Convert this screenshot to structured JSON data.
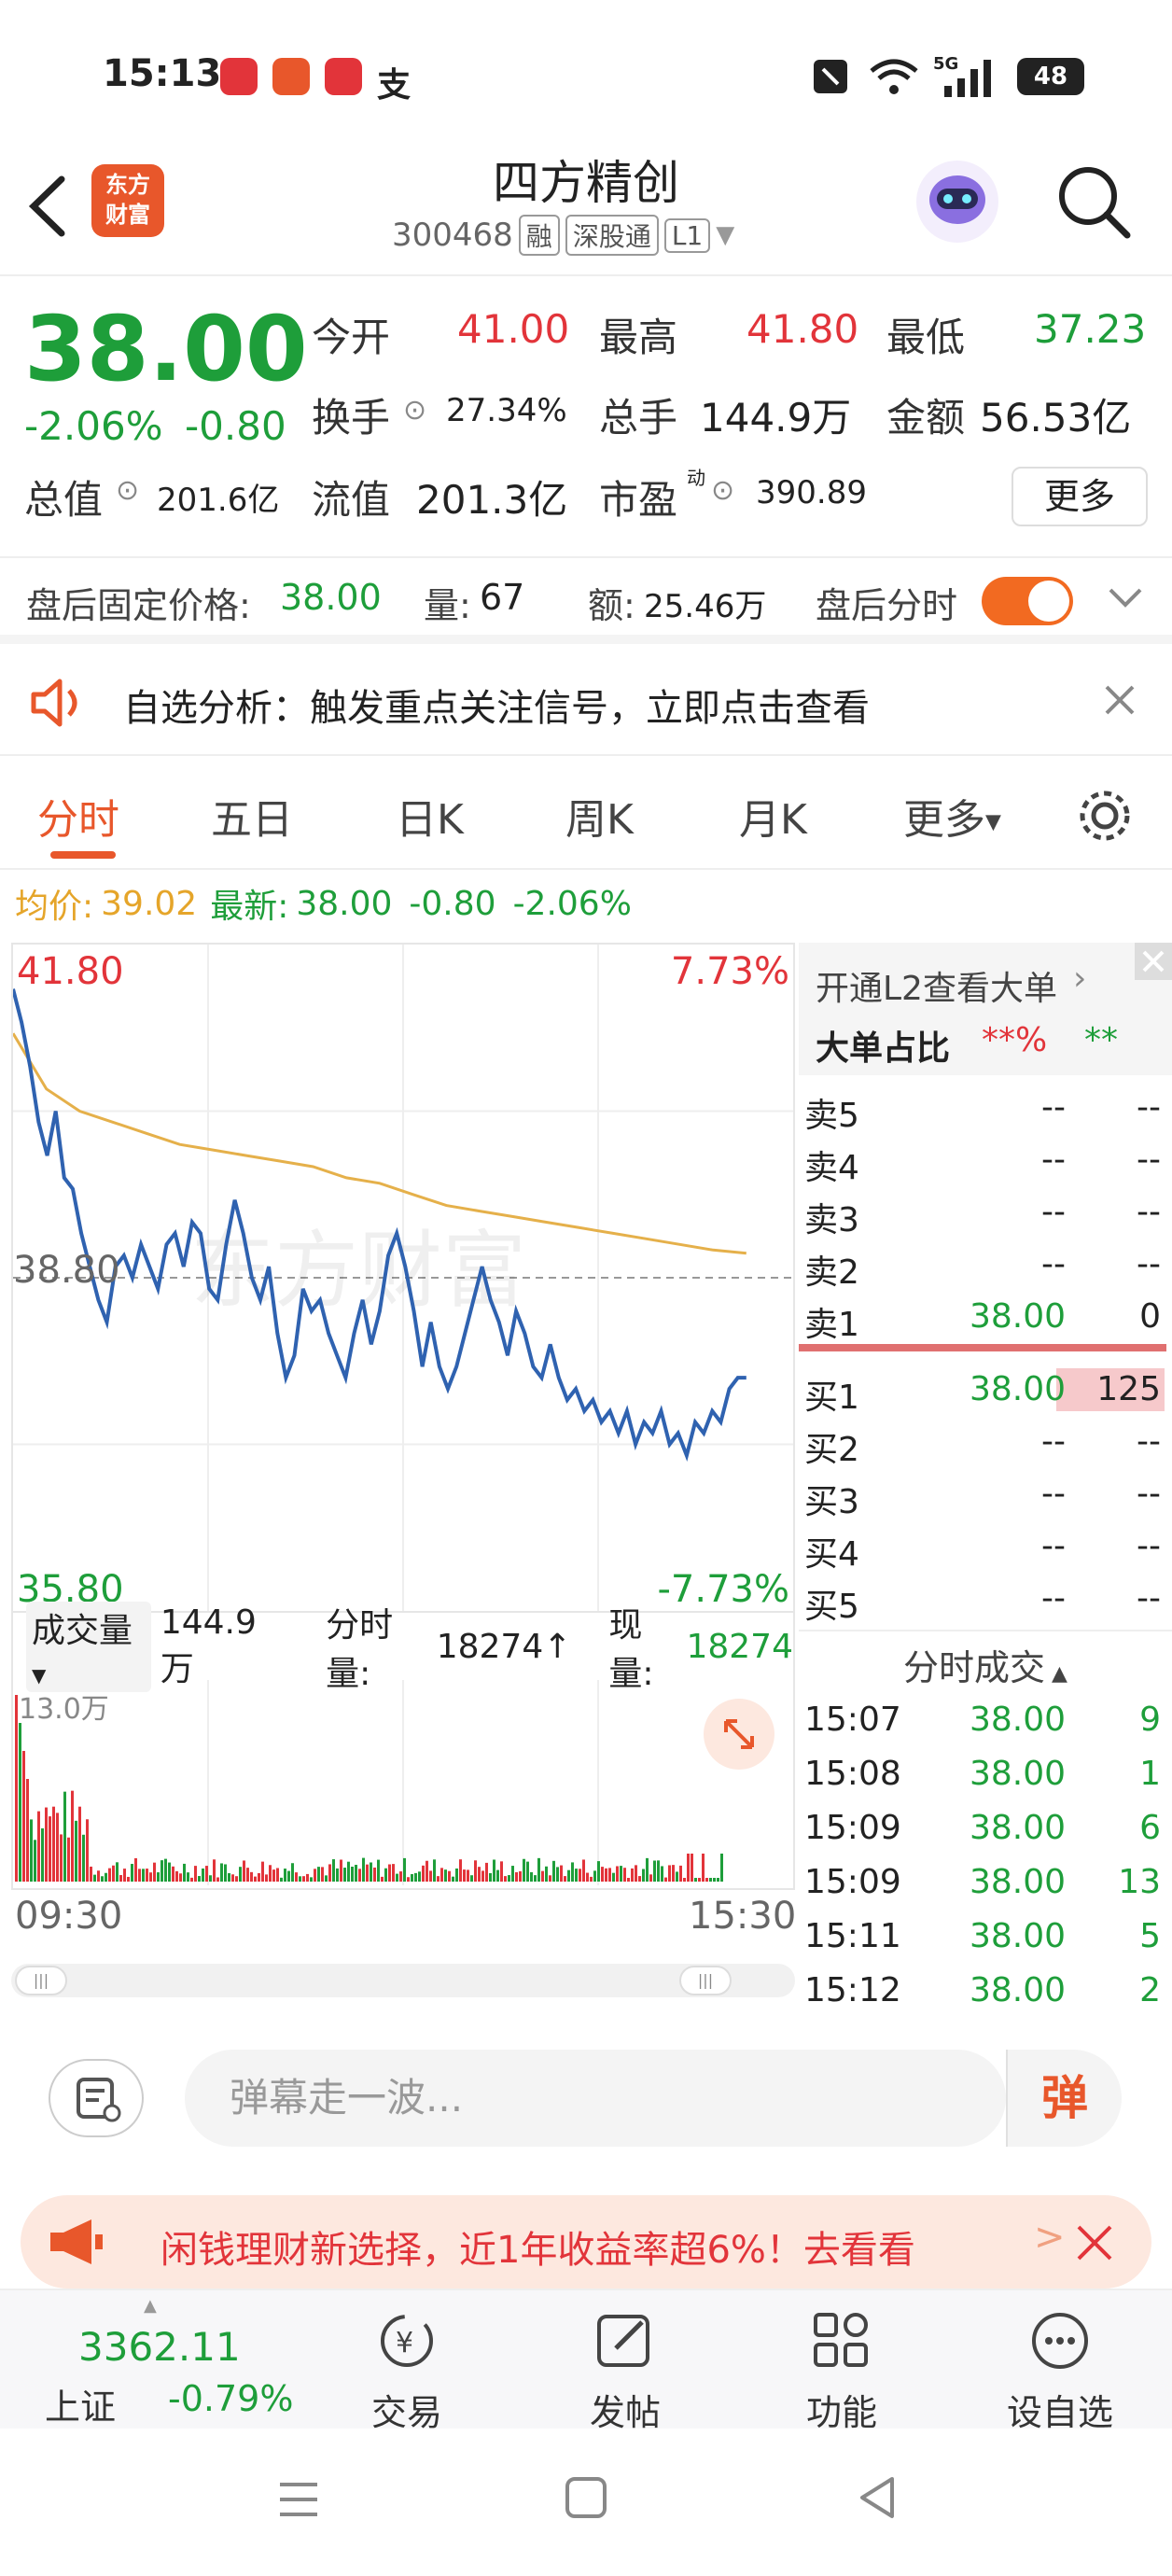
{
  "status_bar": {
    "time": "15:13",
    "battery": "48",
    "signal": "5G"
  },
  "header": {
    "brand_logo": "东方财富",
    "stock_name": "四方精创",
    "stock_code": "300468",
    "tags": [
      "融",
      "深股通",
      "L1"
    ]
  },
  "quote": {
    "price": "38.00",
    "change_pct": "-2.06%",
    "change": "-0.80",
    "open_label": "今开",
    "open": "41.00",
    "high_label": "最高",
    "high": "41.80",
    "low_label": "最低",
    "low": "37.23",
    "turnover_label": "换手",
    "turnover": "27.34%",
    "volume_label": "总手",
    "volume": "144.9万",
    "amount_label": "金额",
    "amount": "56.53亿",
    "mktcap_label": "总值",
    "mktcap": "201.6亿",
    "float_label": "流值",
    "float": "201.3亿",
    "pe_label": "市盈",
    "pe_sup": "动",
    "pe": "390.89",
    "more": "更多"
  },
  "after_hours": {
    "price_label": "盘后固定价格:",
    "price": "38.00",
    "qty_label": "量:",
    "qty": "67",
    "amt_label": "额:",
    "amt": "25.46万",
    "timeshare_label": "盘后分时"
  },
  "notice": {
    "text": "自选分析：触发重点关注信号，立即点击查看"
  },
  "tabs": [
    "分时",
    "五日",
    "日K",
    "周K",
    "月K",
    "更多"
  ],
  "avg_bar": {
    "avg_label": "均价:",
    "avg": "39.02",
    "latest_label": "最新:",
    "latest": "38.00",
    "change": "-0.80",
    "pct": "-2.06%"
  },
  "chart_data": {
    "type": "line",
    "x": [
      "09:30",
      "15:30"
    ],
    "series": [
      {
        "values": [
          41.4,
          41.1,
          40.7,
          40.2,
          39.9,
          40.3,
          39.7,
          39.6,
          39.2,
          38.9,
          38.6,
          38.4,
          38.9,
          39.0,
          38.8,
          39.1,
          38.9,
          38.7,
          39.1,
          39.2,
          38.9,
          39.3,
          39.2,
          38.7,
          38.6,
          39.1,
          39.5,
          39.2,
          38.8,
          38.6,
          38.9,
          38.3,
          37.9,
          38.1,
          38.7,
          38.5,
          38.6,
          38.3,
          38.1,
          37.9,
          38.3,
          38.6,
          38.2,
          38.5,
          39.0,
          39.2,
          38.9,
          38.5,
          38.0,
          38.4,
          38.0,
          37.8,
          38.0,
          38.3,
          38.6,
          38.9,
          38.6,
          38.4,
          38.1,
          38.5,
          38.3,
          38.0,
          37.9,
          38.2,
          37.9,
          37.7,
          37.8,
          37.6,
          37.7,
          37.5,
          37.6,
          37.4,
          37.6,
          37.3,
          37.5,
          37.4,
          37.6,
          37.3,
          37.4,
          37.2,
          37.5,
          37.4,
          37.6,
          37.5,
          37.8,
          37.9,
          37.9
        ]
      },
      {
        "values": [
          41.0,
          40.5,
          40.3,
          40.2,
          40.1,
          40.0,
          39.95,
          39.9,
          39.85,
          39.8,
          39.7,
          39.65,
          39.55,
          39.45,
          39.4,
          39.35,
          39.3,
          39.25,
          39.2,
          39.15,
          39.1,
          39.05,
          39.02
        ]
      }
    ],
    "ylim": [
      35.8,
      41.8
    ],
    "y_labels": {
      "top": "41.80",
      "mid": "38.80",
      "bottom": "35.80"
    },
    "pct_labels": {
      "top": "7.73%",
      "bottom": "-7.73%"
    },
    "reference_line": 38.8,
    "grid": true
  },
  "volume_bar": {
    "label": "成交量",
    "total": "144.9万",
    "timeshare_label": "分时量:",
    "timeshare": "18274↑",
    "current_label": "现量:",
    "current": "18274",
    "max_label": "13.0万",
    "time_start": "09:30",
    "time_end": "15:30"
  },
  "order_book": {
    "l2_link": "开通L2查看大单",
    "big_order_label": "大单占比",
    "big_order_a": "**%",
    "big_order_b": "**",
    "asks": [
      {
        "label": "卖5",
        "price": "--",
        "qty": "--"
      },
      {
        "label": "卖4",
        "price": "--",
        "qty": "--"
      },
      {
        "label": "卖3",
        "price": "--",
        "qty": "--"
      },
      {
        "label": "卖2",
        "price": "--",
        "qty": "--"
      },
      {
        "label": "卖1",
        "price": "38.00",
        "qty": "0"
      }
    ],
    "bids": [
      {
        "label": "买1",
        "price": "38.00",
        "qty": "125"
      },
      {
        "label": "买2",
        "price": "--",
        "qty": "--"
      },
      {
        "label": "买3",
        "price": "--",
        "qty": "--"
      },
      {
        "label": "买4",
        "price": "--",
        "qty": "--"
      },
      {
        "label": "买5",
        "price": "--",
        "qty": "--"
      }
    ]
  },
  "trades": {
    "header": "分时成交",
    "rows": [
      {
        "time": "15:07",
        "price": "38.00",
        "qty": "9"
      },
      {
        "time": "15:08",
        "price": "38.00",
        "qty": "1"
      },
      {
        "time": "15:09",
        "price": "38.00",
        "qty": "6"
      },
      {
        "time": "15:09",
        "price": "38.00",
        "qty": "13"
      },
      {
        "time": "15:11",
        "price": "38.00",
        "qty": "5"
      },
      {
        "time": "15:12",
        "price": "38.00",
        "qty": "2"
      }
    ]
  },
  "danmu": {
    "placeholder": "弹幕走一波...",
    "button": "弹"
  },
  "ad": {
    "text": "闲钱理财新选择，近1年收益率超6%！去看看"
  },
  "bottom_nav": {
    "index_value": "3362.11",
    "index_name": "上证",
    "index_change": "-0.79%",
    "items": [
      "交易",
      "发帖",
      "功能",
      "设自选"
    ]
  },
  "colors": {
    "up": "#e2343a",
    "down": "#1e9e3a",
    "accent": "#e8572b",
    "price_line": "#2f62b0",
    "avg_line": "#e5b04a"
  }
}
